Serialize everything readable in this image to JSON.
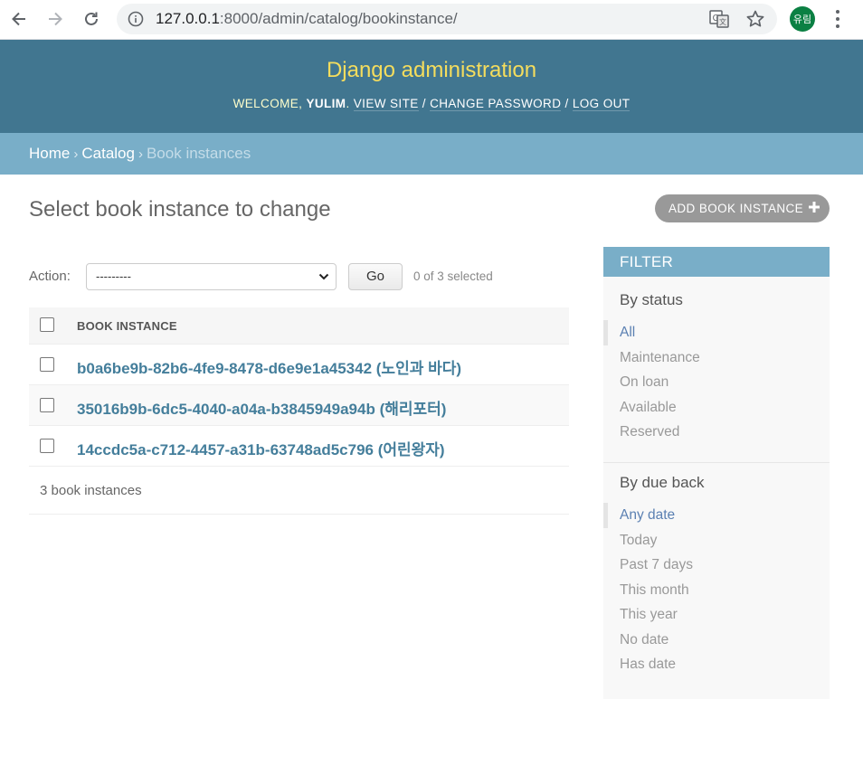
{
  "browser": {
    "url_host": "127.0.0.1",
    "url_rest": ":8000/admin/catalog/bookinstance/",
    "profile_initials": "유림"
  },
  "header": {
    "site_name": "Django administration",
    "welcome_text": "WELCOME, ",
    "username": "YULIM",
    "view_site": "VIEW SITE",
    "change_password": "CHANGE PASSWORD",
    "log_out": "LOG OUT"
  },
  "breadcrumbs": {
    "home": "Home",
    "catalog": "Catalog",
    "current": "Book instances"
  },
  "content": {
    "title": "Select book instance to change",
    "add_button": "ADD BOOK INSTANCE",
    "action_label": "Action:",
    "action_selected": "---------",
    "go_button": "Go",
    "selected_count": "0 of 3 selected",
    "column_header": "BOOK INSTANCE",
    "rows": [
      {
        "label": "b0a6be9b-82b6-4fe9-8478-d6e9e1a45342 (노인과 바다)"
      },
      {
        "label": "35016b9b-6dc5-4040-a04a-b3845949a94b (해리포터)"
      },
      {
        "label": "14ccdc5a-c712-4457-a31b-63748ad5c796 (어린왕자)"
      }
    ],
    "result_count": "3 book instances"
  },
  "filter": {
    "title": "FILTER",
    "by_status": {
      "heading": "By status",
      "options": [
        "All",
        "Maintenance",
        "On loan",
        "Available",
        "Reserved"
      ]
    },
    "by_due_back": {
      "heading": "By due back",
      "options": [
        "Any date",
        "Today",
        "Past 7 days",
        "This month",
        "This year",
        "No date",
        "Has date"
      ]
    }
  },
  "colors": {
    "header_bg": "#417690",
    "breadcrumb_bg": "#79aec8",
    "site_name": "#f5dd5d",
    "link": "#447e9b",
    "filter_selected": "#5b80b2"
  }
}
